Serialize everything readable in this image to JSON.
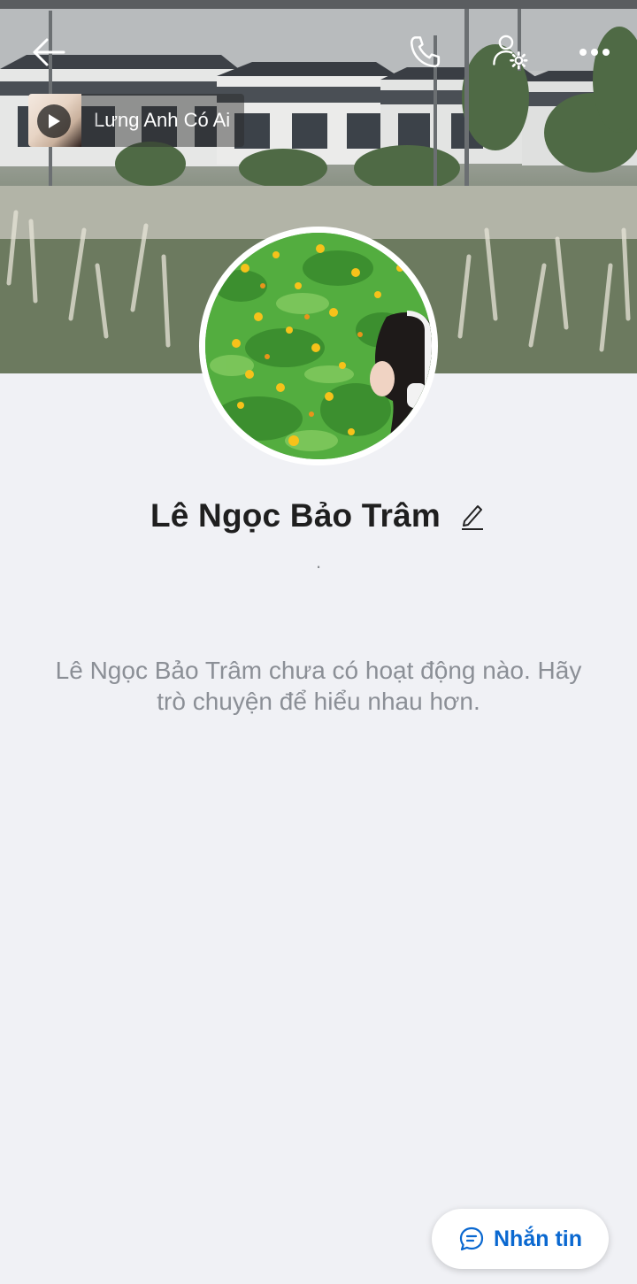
{
  "header": {
    "back_icon": "arrow-left-icon",
    "call_icon": "phone-icon",
    "settings_icon": "user-settings-icon",
    "more_icon": "more-dots-icon"
  },
  "music": {
    "title": "Lưng Anh Có Ai",
    "play_icon": "play-icon"
  },
  "profile": {
    "name": "Lê Ngọc Bảo Trâm",
    "edit_icon": "pencil-icon",
    "bio": "."
  },
  "feed": {
    "empty_message": "Lê Ngọc Bảo Trâm chưa có hoạt động nào. Hãy trò chuyện để hiểu nhau hơn."
  },
  "actions": {
    "message_label": "Nhắn tin",
    "message_icon": "chat-bubble-icon"
  },
  "colors": {
    "accent": "#0a68d0",
    "background": "#f0f1f5",
    "name_text": "#1f1f1f",
    "muted_text": "#8b8f96"
  }
}
